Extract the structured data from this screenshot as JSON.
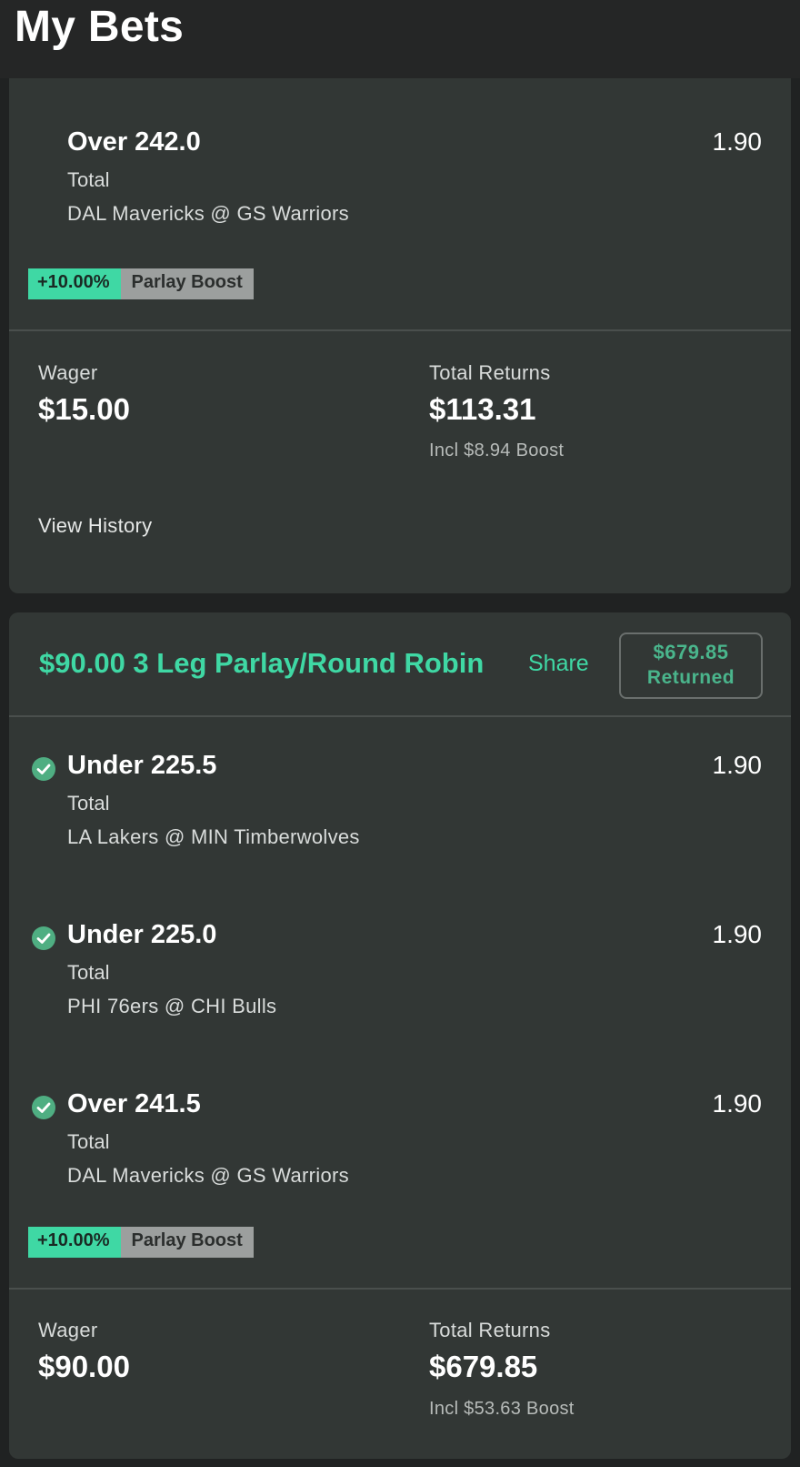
{
  "header": {
    "title": "My Bets"
  },
  "bet1": {
    "legs": [
      {
        "title": "Over 242.0",
        "type": "Total",
        "match": "DAL Mavericks @ GS Warriors",
        "odds": "1.90"
      }
    ],
    "boost": {
      "percent": "+10.00%",
      "label": "Parlay Boost"
    },
    "wager_label": "Wager",
    "wager": "$15.00",
    "returns_label": "Total Returns",
    "returns": "$113.31",
    "boost_note": "Incl $8.94 Boost",
    "history_link": "View History"
  },
  "bet2": {
    "title": "$90.00 3 Leg Parlay/Round Robin",
    "share_label": "Share",
    "returned_amount": "$679.85",
    "returned_label": "Returned",
    "legs": [
      {
        "title": "Under 225.5",
        "type": "Total",
        "match": "LA Lakers @ MIN Timberwolves",
        "odds": "1.90",
        "status": "won"
      },
      {
        "title": "Under 225.0",
        "type": "Total",
        "match": "PHI 76ers @ CHI Bulls",
        "odds": "1.90",
        "status": "won"
      },
      {
        "title": "Over 241.5",
        "type": "Total",
        "match": "DAL Mavericks @ GS Warriors",
        "odds": "1.90",
        "status": "won"
      }
    ],
    "boost": {
      "percent": "+10.00%",
      "label": "Parlay Boost"
    },
    "wager_label": "Wager",
    "wager": "$90.00",
    "returns_label": "Total Returns",
    "returns": "$679.85",
    "boost_note": "Incl $53.63 Boost"
  },
  "colors": {
    "accent": "#3fd8a4",
    "returned": "#4ab58c",
    "card": "#323735",
    "background": "#202222"
  },
  "icons": {
    "leg_status": "check-circle-icon"
  }
}
